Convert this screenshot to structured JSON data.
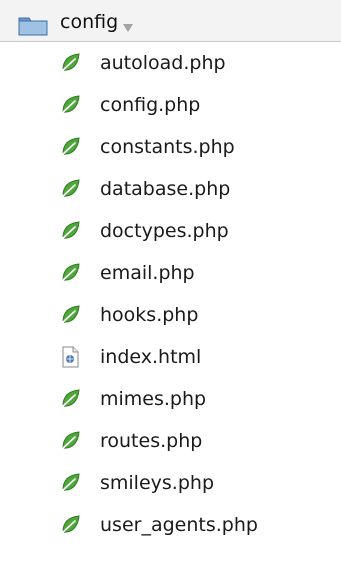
{
  "folder": {
    "name": "config",
    "icon": "folder-icon",
    "dropdown_icon": "chevron-down-icon"
  },
  "files": [
    {
      "name": "autoload.php",
      "icon": "leaf-icon"
    },
    {
      "name": "config.php",
      "icon": "leaf-icon"
    },
    {
      "name": "constants.php",
      "icon": "leaf-icon"
    },
    {
      "name": "database.php",
      "icon": "leaf-icon"
    },
    {
      "name": "doctypes.php",
      "icon": "leaf-icon"
    },
    {
      "name": "email.php",
      "icon": "leaf-icon"
    },
    {
      "name": "hooks.php",
      "icon": "leaf-icon"
    },
    {
      "name": "index.html",
      "icon": "html-file-icon"
    },
    {
      "name": "mimes.php",
      "icon": "leaf-icon"
    },
    {
      "name": "routes.php",
      "icon": "leaf-icon"
    },
    {
      "name": "smileys.php",
      "icon": "leaf-icon"
    },
    {
      "name": "user_agents.php",
      "icon": "leaf-icon"
    }
  ],
  "colors": {
    "folder": "#5e8fc5",
    "leaf": "#4fa63a",
    "html_icon": "#4a78b5"
  }
}
